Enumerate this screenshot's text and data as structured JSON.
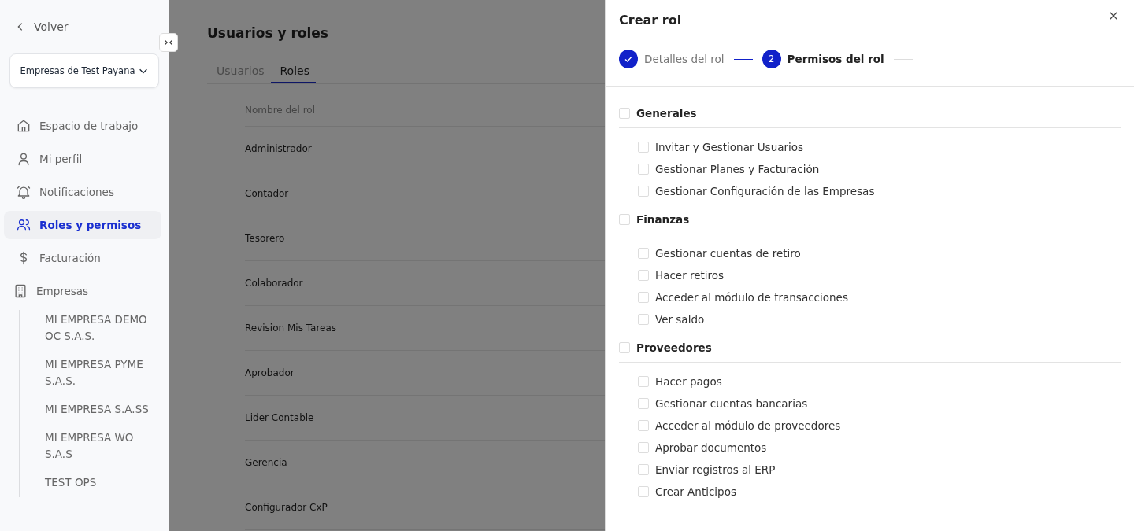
{
  "sidebar": {
    "back": "Volver",
    "company_select": "Empresas de Test Payana",
    "items": [
      {
        "label": "Espacio de trabajo",
        "selected": false
      },
      {
        "label": "Mi perfil",
        "selected": false
      },
      {
        "label": "Notificaciones",
        "selected": false
      },
      {
        "label": "Roles y permisos",
        "selected": true
      },
      {
        "label": "Facturación",
        "selected": false
      }
    ],
    "companies": {
      "label": "Empresas",
      "children": [
        "MI EMPRESA DEMO OC S.A.S.",
        "MI EMPRESA PYME S.A.S.",
        "MI EMPRESA S.A.SS",
        "MI EMPRESA WO S.A.S",
        "TEST OPS"
      ]
    }
  },
  "main": {
    "title": "Usuarios y roles",
    "tabs": [
      {
        "label": "Usuarios",
        "selected": false
      },
      {
        "label": "Roles",
        "selected": true
      }
    ],
    "table": {
      "columns": [
        "Nombre del rol"
      ],
      "rows": [
        "Administrador",
        "Contador",
        "Tesorero",
        "Colaborador",
        "Revision Mis Tareas",
        "Aprobador",
        "Lider Contable",
        "Gerencia",
        "Configurador CxP"
      ]
    }
  },
  "drawer": {
    "title": "Crear rol",
    "steps": [
      {
        "label": "Detalles del rol",
        "done": true,
        "active": false
      },
      {
        "number": "2",
        "label": "Permisos del rol",
        "done": false,
        "active": true
      }
    ],
    "groups": [
      {
        "label": "Generales",
        "checked": false,
        "permissions": [
          {
            "label": "Invitar y Gestionar Usuarios",
            "checked": false
          },
          {
            "label": "Gestionar Planes y Facturación",
            "checked": false
          },
          {
            "label": "Gestionar Configuración de las Empresas",
            "checked": false
          }
        ]
      },
      {
        "label": "Finanzas",
        "checked": false,
        "permissions": [
          {
            "label": "Gestionar cuentas de retiro",
            "checked": false
          },
          {
            "label": "Hacer retiros",
            "checked": false
          },
          {
            "label": "Acceder al módulo de transacciones",
            "checked": false
          },
          {
            "label": "Ver saldo",
            "checked": false
          }
        ]
      },
      {
        "label": "Proveedores",
        "checked": false,
        "permissions": [
          {
            "label": "Hacer pagos",
            "checked": false
          },
          {
            "label": "Gestionar cuentas bancarias",
            "checked": false
          },
          {
            "label": "Acceder al módulo de proveedores",
            "checked": false
          },
          {
            "label": "Aprobar documentos",
            "checked": false
          },
          {
            "label": "Enviar registros al ERP",
            "checked": false
          },
          {
            "label": "Crear Anticipos",
            "checked": false
          }
        ]
      }
    ]
  }
}
